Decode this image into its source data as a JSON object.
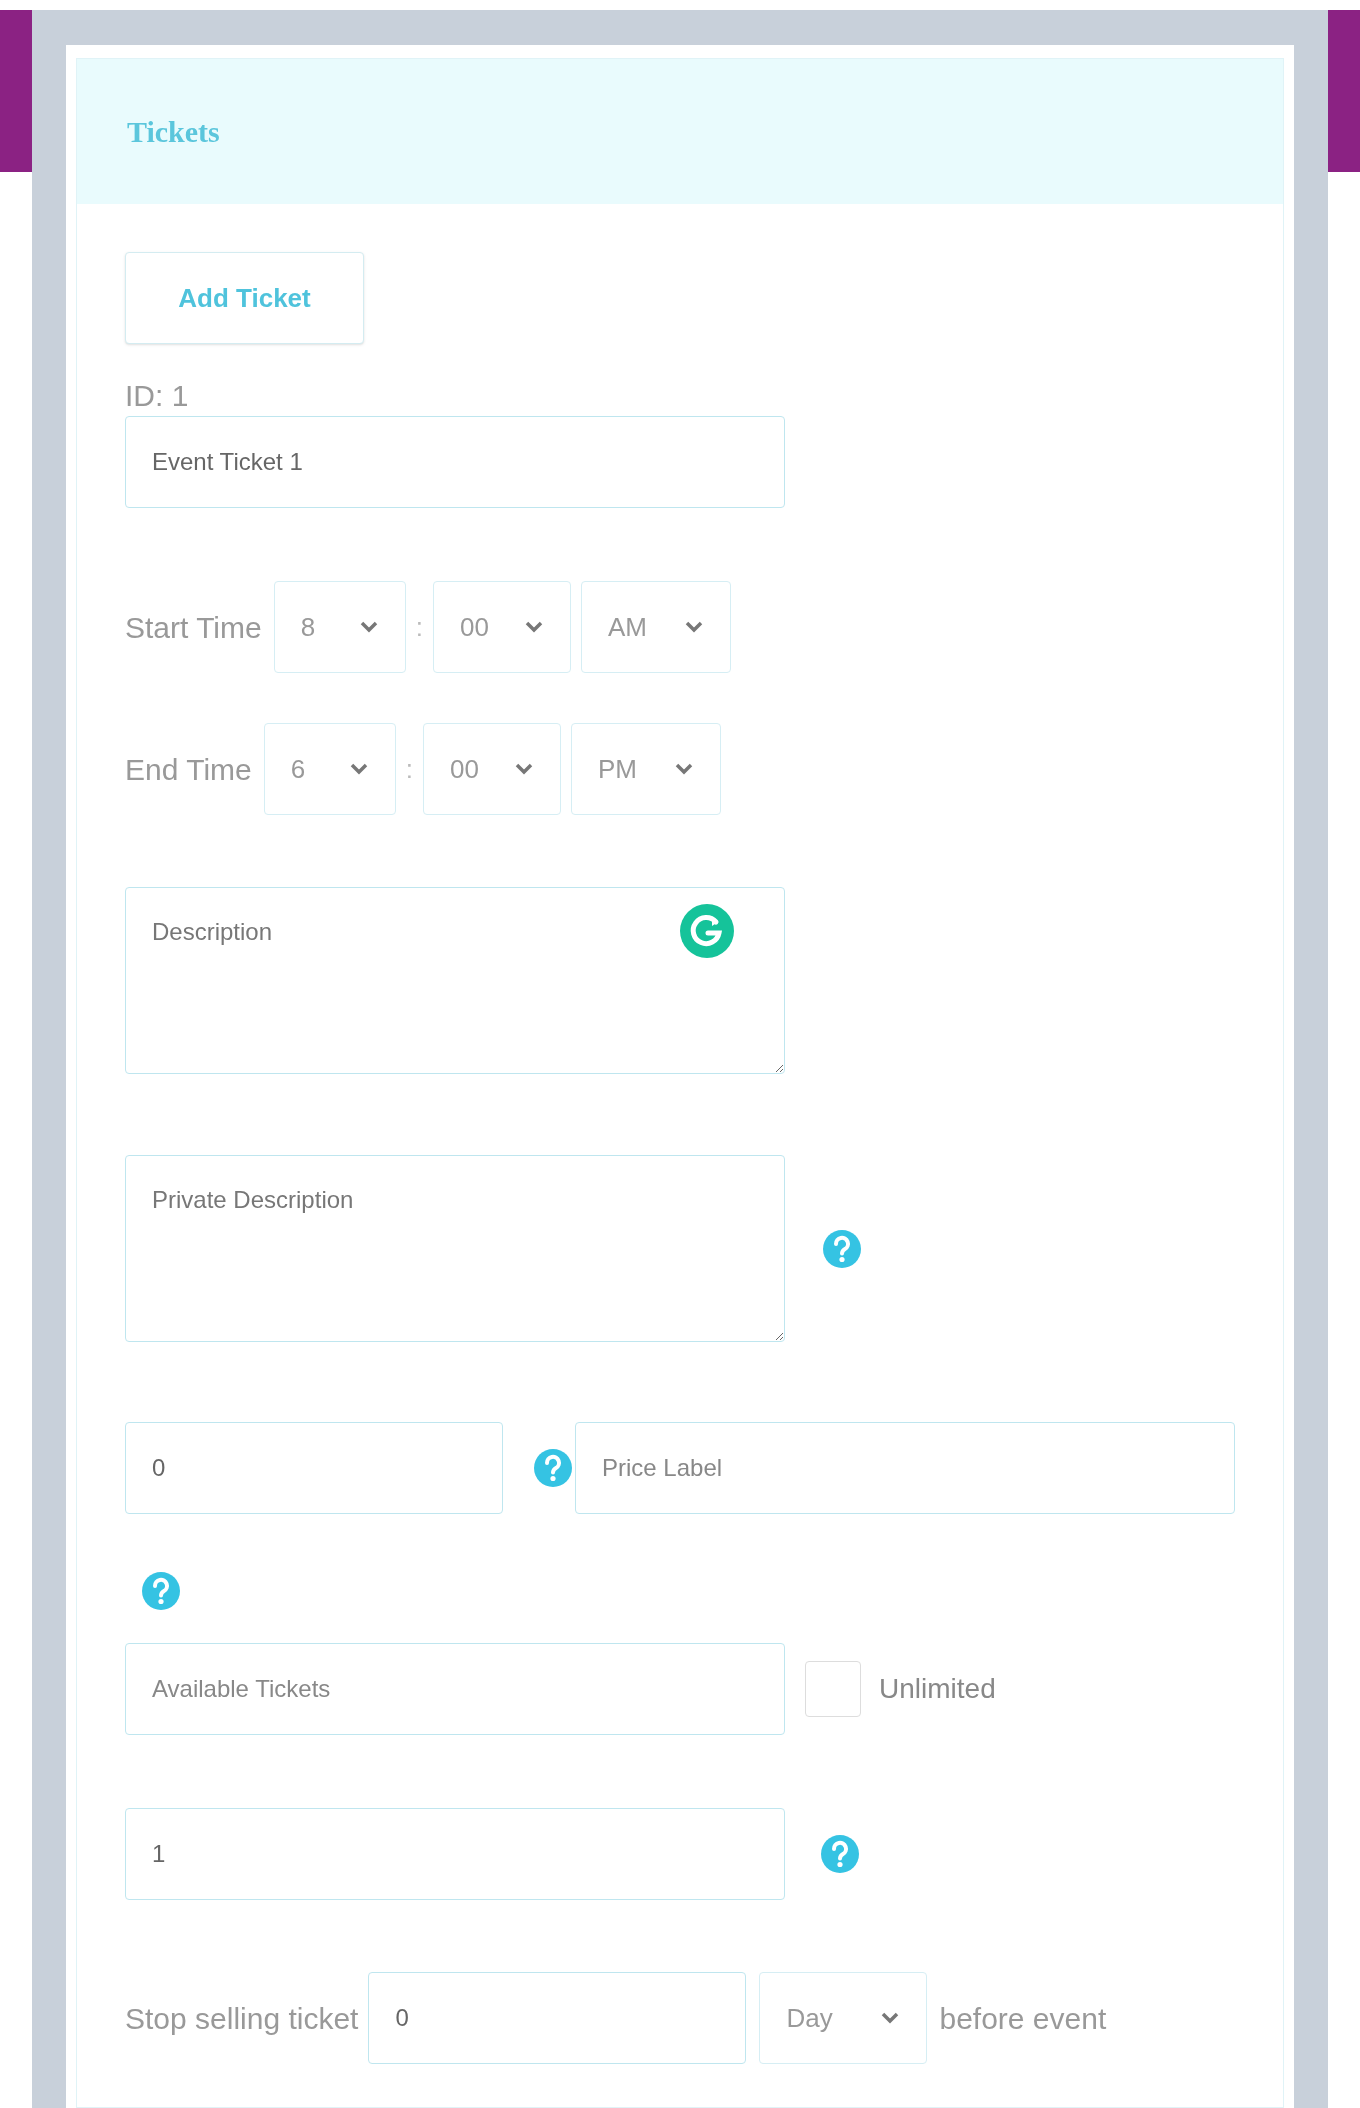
{
  "panel": {
    "title": "Tickets"
  },
  "add_button": {
    "label": "Add Ticket"
  },
  "ticket": {
    "id_label": "ID: 1",
    "name_field": {
      "value": "Event Ticket 1"
    },
    "times": [
      {
        "label": "Start Time",
        "hour": "8",
        "separator": ":",
        "minute": "00",
        "period": "AM"
      },
      {
        "label": "End Time",
        "hour": "6",
        "separator": ":",
        "minute": "00",
        "period": "PM"
      }
    ],
    "description": {
      "placeholder": "Description"
    },
    "private_description": {
      "placeholder": "Private Description"
    },
    "price": {
      "value": "0"
    },
    "price_label": {
      "placeholder": "Price Label"
    },
    "available_tickets": {
      "placeholder": "Available Tickets"
    },
    "unlimited": {
      "label": "Unlimited",
      "checked": false
    },
    "quantity_field": {
      "value": "1"
    },
    "stop_selling": {
      "label": "Stop selling ticket",
      "value": "0",
      "unit": "Day",
      "suffix": "before event"
    }
  }
}
